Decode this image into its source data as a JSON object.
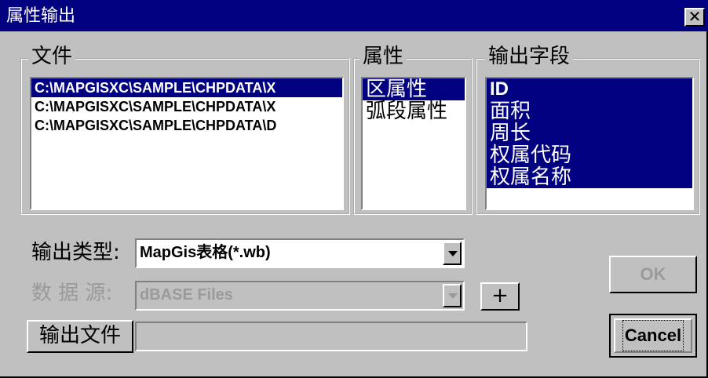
{
  "window": {
    "title": "属性输出",
    "close_glyph": "✕"
  },
  "files_group": {
    "label": "文件",
    "items": [
      "C:\\MAPGISXC\\SAMPLE\\CHPDATA\\X",
      "C:\\MAPGISXC\\SAMPLE\\CHPDATA\\X",
      "C:\\MAPGISXC\\SAMPLE\\CHPDATA\\D"
    ],
    "selected_index": 0
  },
  "attr_group": {
    "label": "属性",
    "items": [
      "区属性",
      "弧段属性"
    ],
    "selected_index": 0
  },
  "fields_group": {
    "label": "输出字段",
    "items": [
      "ID",
      "面积",
      "周长",
      "权属代码",
      "权属名称"
    ],
    "all_selected": true
  },
  "output_type": {
    "label": "输出类型:",
    "value": "MapGis表格(*.wb)"
  },
  "data_source": {
    "label": "数 据 源:",
    "value": "dBASE Files",
    "disabled": true
  },
  "plus_button": {
    "label": "+"
  },
  "output_file": {
    "button_label": "输出文件",
    "value": ""
  },
  "ok_button": {
    "label": "OK",
    "disabled": true
  },
  "cancel_button": {
    "label": "Cancel"
  },
  "colors": {
    "selection": "#000080",
    "face": "#c0c0c0",
    "disabled_text": "#9a9a9a"
  }
}
